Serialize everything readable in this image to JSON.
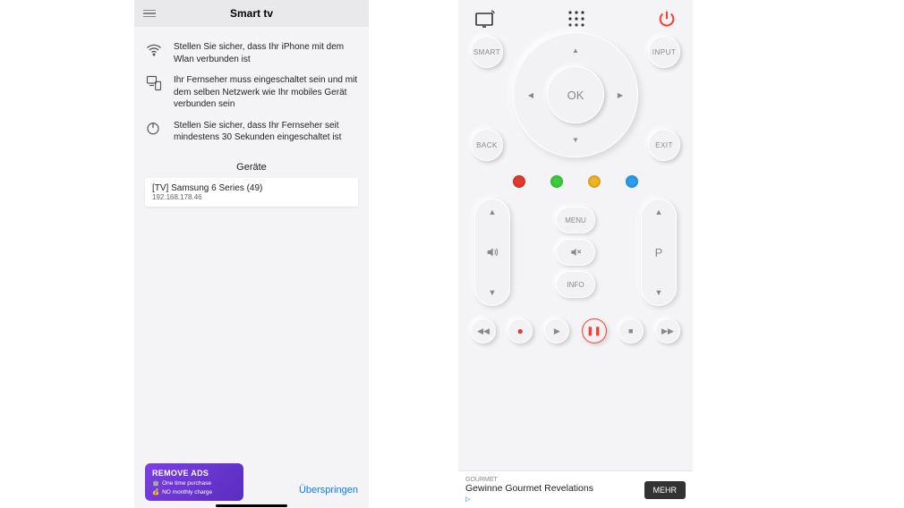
{
  "left": {
    "title": "Smart tv",
    "tips": [
      "Stellen Sie sicher, dass Ihr iPhone mit dem Wlan verbunden ist",
      "Ihr Fernseher muss eingeschaltet sein und mit dem selben Netzwerk wie Ihr mobiles Gerät verbunden sein",
      "Stellen Sie sicher, dass Ihr Fernseher seit mindestens 30 Sekunden eingeschaltet ist"
    ],
    "devices_header": "Geräte",
    "device": {
      "name": "[TV] Samsung 6 Series (49)",
      "ip": "192.168.178.46"
    },
    "ad": {
      "title": "REMOVE ADS",
      "line1": "One time purchase",
      "line2": "NO monthly charge"
    },
    "skip": "Überspringen"
  },
  "right": {
    "buttons": {
      "smart": "SMART",
      "input": "INPUT",
      "ok": "OK",
      "back": "BACK",
      "exit": "EXIT",
      "menu": "MENU",
      "info": "INFO",
      "program": "P"
    },
    "color_buttons": [
      "red",
      "green",
      "yellow",
      "blue"
    ],
    "banner": {
      "brand": "GOURMET",
      "headline": "Gewinne Gourmet Revelations",
      "cta": "MEHR"
    }
  }
}
